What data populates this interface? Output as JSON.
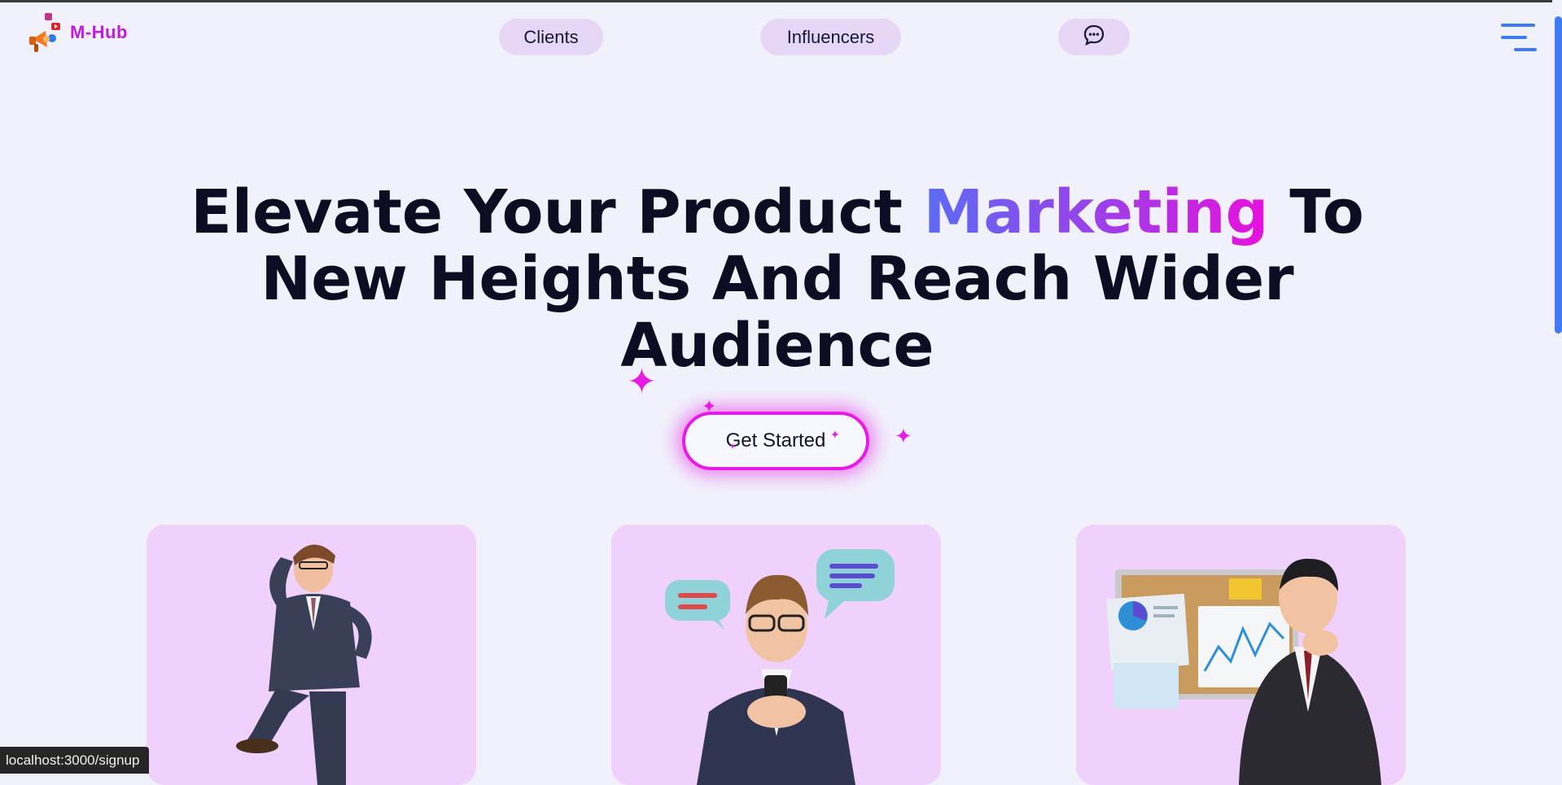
{
  "brand": {
    "name": "M-Hub",
    "color": "#c21bdf"
  },
  "nav": {
    "clients_label": "Clients",
    "influencers_label": "Influencers",
    "chat_icon": "chat-bubble-icon",
    "menu_icon": "hamburger-menu-icon"
  },
  "hero": {
    "title_part1": "Elevate Your Product ",
    "title_highlight": "Marketing",
    "title_part2": " To New Heights And Reach Wider Audience",
    "cta_label": "Get Started",
    "accent_gradient": [
      "#5b6cf3",
      "#a23ce8",
      "#ea10dc"
    ],
    "cta_glow_color": "#e81be4"
  },
  "cards": [
    {
      "illustration": "businessman-looking-ahead-illustration"
    },
    {
      "illustration": "businessman-texting-with-chat-bubbles-illustration"
    },
    {
      "illustration": "businessman-thinking-with-charts-board-illustration"
    }
  ],
  "status_bar": {
    "url": "localhost:3000/signup"
  },
  "colors": {
    "background": "#f1f1fb",
    "nav_pill": "#e7d7f6",
    "card": "#efd1fb",
    "scroll_thumb": "#3f7bf5"
  }
}
